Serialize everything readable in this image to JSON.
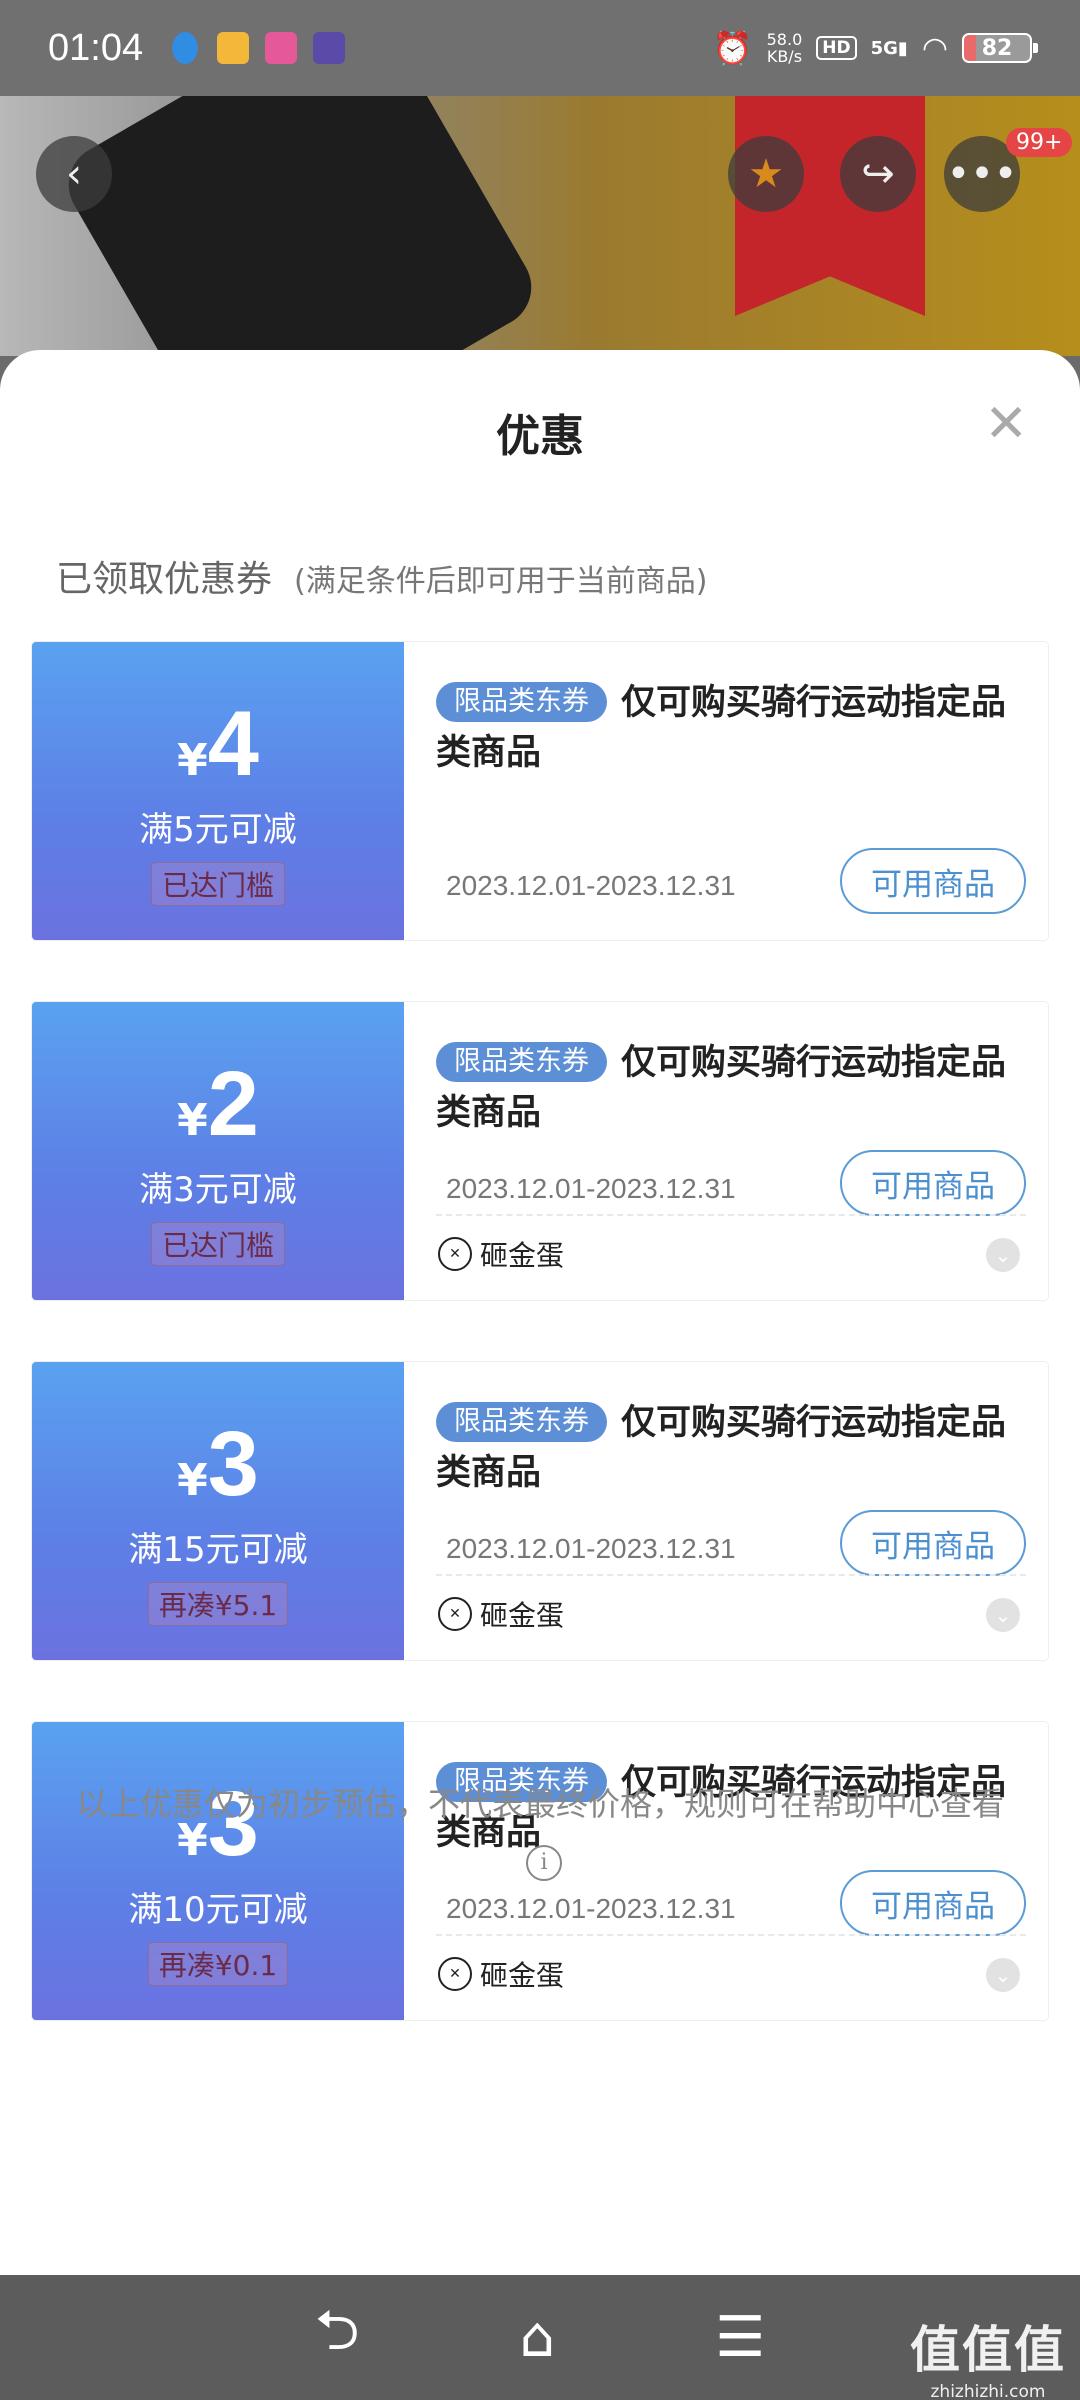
{
  "status_bar": {
    "time": "01:04",
    "net_speed_value": "58.0",
    "net_speed_unit": "KB/s",
    "hd": "HD",
    "signal": "5G",
    "battery": "82"
  },
  "header": {
    "badge": "99+"
  },
  "sheet": {
    "title": "优惠",
    "section_title": "已领取优惠券",
    "section_note": "(满足条件后即可用于当前商品)"
  },
  "coupons": [
    {
      "currency": "¥",
      "amount": "4",
      "condition": "满5元可减",
      "threshold": "已达门槛",
      "tag": "限品类东券",
      "title": "仅可购买骑行运动指定品类商品",
      "validity": "2023.12.01-2023.12.31",
      "button": "可用商品"
    },
    {
      "currency": "¥",
      "amount": "2",
      "condition": "满3元可减",
      "threshold": "已达门槛",
      "tag": "限品类东券",
      "title": "仅可购买骑行运动指定品类商品",
      "validity": "2023.12.01-2023.12.31",
      "button": "可用商品",
      "source": "砸金蛋"
    },
    {
      "currency": "¥",
      "amount": "3",
      "condition": "满15元可减",
      "threshold": "再凑¥5.1",
      "tag": "限品类东券",
      "title": "仅可购买骑行运动指定品类商品",
      "validity": "2023.12.01-2023.12.31",
      "button": "可用商品",
      "source": "砸金蛋"
    },
    {
      "currency": "¥",
      "amount": "3",
      "condition": "满10元可减",
      "threshold": "再凑¥0.1",
      "tag": "限品类东券",
      "title": "仅可购买骑行运动指定品类商品",
      "validity": "2023.12.01-2023.12.31",
      "button": "可用商品",
      "source": "砸金蛋"
    }
  ],
  "disclaimer": "以上优惠仅为初步预估，不代表最终价格，规则可在帮助中心查看",
  "watermark": {
    "logo": "值值值",
    "url": "zhizhizhi.com"
  },
  "colors": {
    "coupon_gradient_top": "#5aa2f0",
    "coupon_gradient_bottom": "#6b72e0",
    "tag_blue": "#5d8fd6",
    "button_blue": "#4d90d0"
  }
}
